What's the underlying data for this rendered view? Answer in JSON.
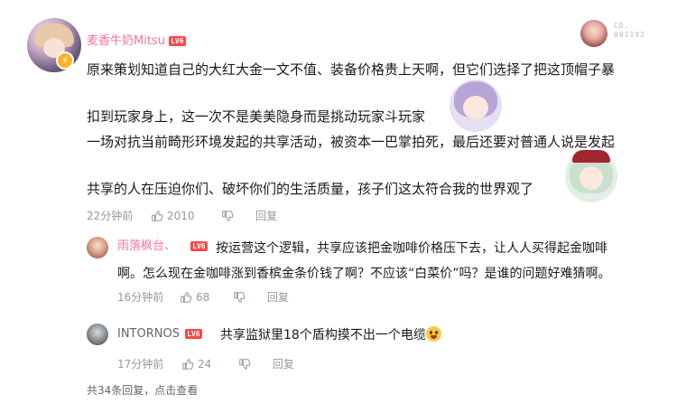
{
  "comment": {
    "username": "麦香牛奶Mitsu",
    "level": "LV6",
    "username_color": "#fb7299",
    "corner_code": [
      "CD.",
      "001192"
    ],
    "lines": [
      "原来策划知道自己的大红大金一文不值、装备价格贵上天啊，但它们选择了把这顶帽子暴",
      "扣到玩家身上，这一次不是美美隐身而是挑动玩家斗玩家",
      "一场对抗当前畸形环境发起的共享活动，被资本一巴掌拍死，最后还要对普通人说是发起",
      "共享的人在压迫你们、破坏你们的生活质量，孩子们这太符合我的世界观了"
    ],
    "time": "22分钟前",
    "likes": "2010",
    "reply_label": "回复"
  },
  "replies": [
    {
      "username": "雨落枫台、",
      "level": "LV6",
      "username_color": "#fb7299",
      "lines": [
        "按运营这个逻辑，共享应该把金咖啡价格压下去，让人人买得起金咖啡",
        "啊。怎么现在金咖啡涨到香槟金条价钱了啊？不应该“白菜价”吗？是谁的问题好难猜啊。"
      ],
      "time": "16分钟前",
      "likes": "68",
      "reply_label": "回复"
    },
    {
      "username": "INTORNOS",
      "level": "LV6",
      "username_color": "#61666d",
      "text": "共享监狱里18个盾构摸不出一个电缆",
      "time": "17分钟前",
      "likes": "24",
      "reply_label": "回复"
    }
  ],
  "footer": {
    "total": "共34条回复，",
    "view_link": "点击查看"
  },
  "icons": {
    "like": "thumbs-up-icon",
    "dislike": "thumbs-down-icon",
    "verified": "lightning-badge-icon",
    "emoji": "wow-emoji-icon"
  },
  "colors": {
    "accent_pink": "#fb7299",
    "level_red": "#f24a4a",
    "meta_gray": "#9499a0",
    "text": "#18191c"
  }
}
